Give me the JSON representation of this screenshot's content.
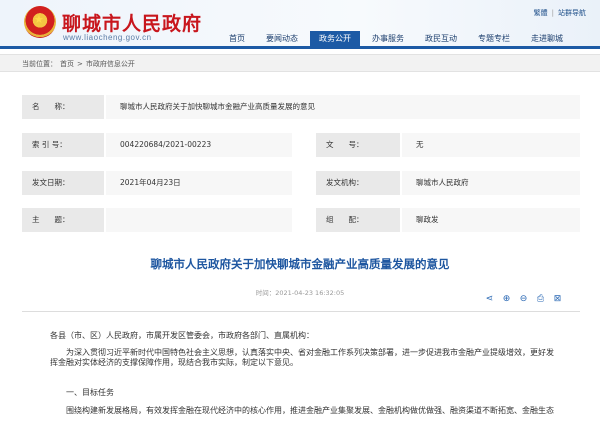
{
  "header": {
    "site_title": "聊城市人民政府",
    "site_url": "www.liaocheng.gov.cn",
    "top_links": [
      "繁體",
      "站群导航"
    ],
    "nav": [
      "首页",
      "要闻动态",
      "政务公开",
      "办事服务",
      "政民互动",
      "专题专栏",
      "走进聊城"
    ],
    "active_nav": "政务公开"
  },
  "breadcrumb": {
    "prefix": "当前位置：",
    "items": [
      "首页",
      "市政府信息公开"
    ],
    "sep": ">"
  },
  "info": {
    "name_label": "名　　称：",
    "name_value": "聊城市人民政府关于加快聊城市金融产业高质量发展的意见",
    "index_label": "索 引 号：",
    "index_value": "004220684/2021-00223",
    "doc_label": "文　　号：",
    "doc_value": "无",
    "date_label": "发文日期：",
    "date_value": "2021年04月23日",
    "org_label": "发文机构：",
    "org_value": "聊城市人民政府",
    "subject_label": "主　　题：",
    "subject_value": "",
    "category_label": "组　　配：",
    "category_value": "聊政发"
  },
  "article": {
    "title": "聊城市人民政府关于加快聊城市金融产业高质量发展的意见",
    "meta": "时间：2021-04-23 16:32:05",
    "tools": [
      "share-icon",
      "font-large-icon",
      "font-small-icon",
      "print-icon",
      "close-icon"
    ],
    "p1": "各县（市、区）人民政府，市属开发区管委会，市政府各部门、直属机构：",
    "p2": "为深入贯彻习近平新时代中国特色社会主义思想，认真落实中央、省对金融工作系列决策部署，进一步促进我市金融产业提级增效，更好发",
    "p3": "挥金融对实体经济的支撑保障作用，现结合我市实际，制定以下意见。",
    "p4": "一、目标任务",
    "p5": "围绕构建新发展格局，有效发挥金融在现代经济中的核心作用，推进金融产业集聚发展、金融机构做优做强、融资渠道不断拓宽、金融生态"
  }
}
